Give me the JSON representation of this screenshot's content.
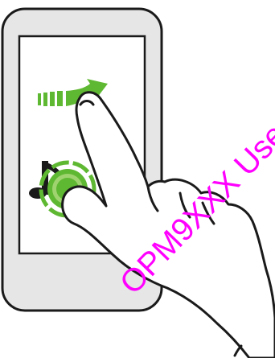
{
  "watermark": {
    "text": "OPM9XXX Use",
    "color": "#ff00ff"
  },
  "colors": {
    "phone_body": "#e6e6e6",
    "phone_outline": "#1a1a1a",
    "screen": "#ffffff",
    "gesture_green": "#5fb832",
    "gesture_green_light": "#9ed36f",
    "hand_fill": "#ffffff",
    "hand_outline": "#1a1a1a"
  },
  "icons": {
    "swipe_arrow": "swipe-right-arrow-icon",
    "touch_point": "touch-and-hold-icon",
    "music_note": "music-note-icon"
  }
}
